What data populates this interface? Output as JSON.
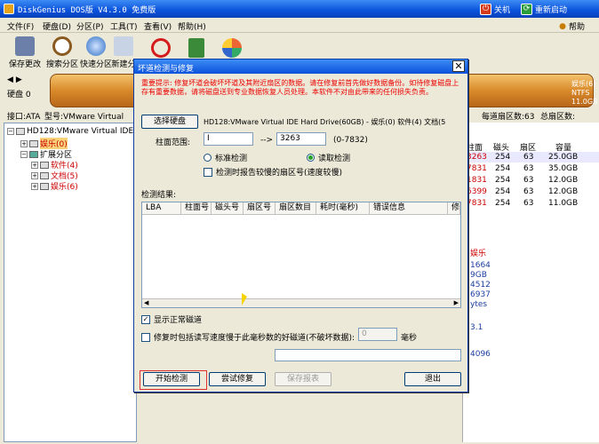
{
  "app": {
    "title": "DiskGenius DOS版 V4.3.0 免费版",
    "shutdown_label": "关机",
    "reboot_label": "重新启动"
  },
  "menu": {
    "items": [
      "文件(F)",
      "硬盘(D)",
      "分区(P)",
      "工具(T)",
      "查看(V)",
      "帮助(H)"
    ],
    "help_label": "帮助"
  },
  "toolbar": {
    "items": [
      "保存更改",
      "搜索分区",
      "快速分区",
      "新建分"
    ]
  },
  "diskbar": {
    "disk_label": "硬盘 0",
    "partition_name": "娱乐(6)",
    "partition_fs": "NTFS",
    "partition_size": "11.0GB"
  },
  "infoline": {
    "interface": "接口:ATA",
    "model": "型号:VMware Virtual",
    "sectors_per_track": "每道扇区数:63",
    "total_sectors": "总扇区数:"
  },
  "tree": {
    "disk": "HD128:VMware Virtual IDE H",
    "partitions": [
      "娱乐(0)",
      "扩展分区",
      "软件(4)",
      "文档(5)",
      "娱乐(6)"
    ]
  },
  "right_table": {
    "headers": [
      "柱面",
      "磁头",
      "扇区",
      "容量"
    ],
    "rows": [
      [
        "3263",
        "254",
        "63",
        "25.0GB"
      ],
      [
        "7831",
        "254",
        "63",
        "35.0GB"
      ],
      [
        "1831",
        "254",
        "63",
        "12.0GB"
      ],
      [
        "6399",
        "254",
        "63",
        "12.0GB"
      ],
      [
        "7831",
        "254",
        "63",
        "11.0GB"
      ]
    ],
    "extra": [
      "娱乐",
      "1664",
      "9GB",
      "4512",
      "6937",
      "ytes",
      "3.1",
      "4096"
    ]
  },
  "dialog": {
    "title": "坏道检测与修复",
    "warning": "重要提示: 修复坏道会破坏坏道及其附近扇区的数据。请在修复前首先做好数据备份。如待修复磁盘上存有重要数据，请将磁盘送到专业数据恢复人员处理。本软件不对由此带来的任何损失负责。",
    "select_disk_label": "选择硬盘",
    "disk_info": "HD128:VMware Virtual IDE Hard Drive(60GB) - 娱乐(0) 软件(4) 文档(5",
    "cylinder_label": "柱面范围:",
    "cylinder_from": "I",
    "cylinder_arrow": "-->",
    "cylinder_to": "3263",
    "cylinder_range": "(0-7832)",
    "standard_check": "标准检测",
    "read_check": "读取检测",
    "report_slow": "检测时报告较慢的扇区号(速度较慢)",
    "results_label": "检测结果:",
    "columns": [
      "LBA",
      "柱面号",
      "磁头号",
      "扇区号",
      "扇区数目",
      "耗时(毫秒)",
      "错误信息",
      "修"
    ],
    "show_normal": "显示正常磁道",
    "repair_slow": "修复时包括读写速度慢于此毫秒数的好磁道(不破坏数据):",
    "ms_value": "0",
    "ms_unit": "毫秒",
    "start_button": "开始检测",
    "try_repair_button": "尝试修复",
    "save_report_button": "保存报表",
    "exit_button": "退出"
  }
}
